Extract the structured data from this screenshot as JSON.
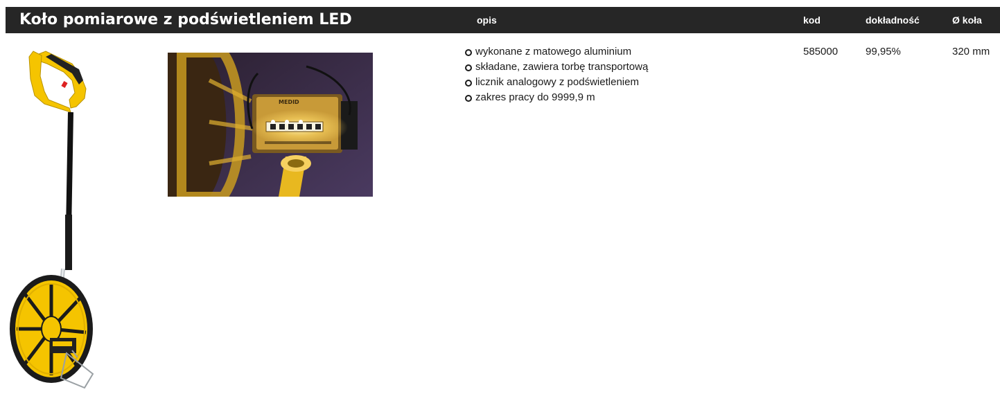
{
  "header": {
    "title": "Koło pomiarowe z podświetleniem LED",
    "columns": {
      "opis": "opis",
      "kod": "kod",
      "dokladnosc": "dokładność",
      "srednica": "Ø koła"
    }
  },
  "product": {
    "features": [
      "wykonane z matowego aluminium",
      "składane, zawiera torbę transportową",
      "licznik analogowy z podświetleniem",
      "zakres pracy do 9999,9 m"
    ],
    "kod": "585000",
    "dokladnosc": "99,95%",
    "srednica": "320 mm"
  },
  "images": {
    "main_photo": "measuring-wheel-photo",
    "detail_photo": "led-counter-closeup-photo"
  },
  "colors": {
    "header_bg": "#262626",
    "header_text": "#ffffff",
    "body_text": "#1a1a1a",
    "wheel_yellow": "#f5c400",
    "detail_bg": "#3a2a4a"
  }
}
